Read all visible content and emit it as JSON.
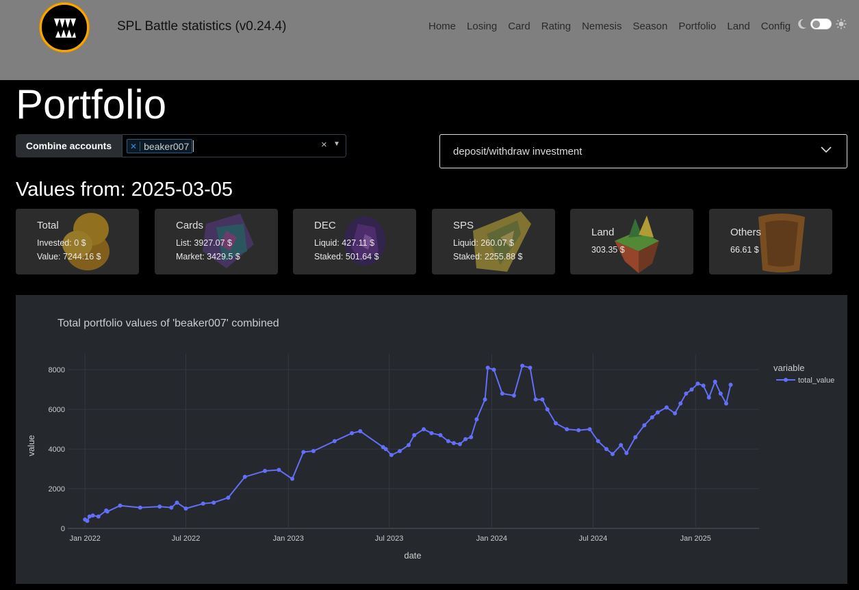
{
  "app": {
    "title": "SPL Battle statistics (v0.24.4)"
  },
  "nav": [
    "Home",
    "Losing",
    "Card",
    "Rating",
    "Nemesis",
    "Season",
    "Portfolio",
    "Land",
    "Config"
  ],
  "page": {
    "title": "Portfolio",
    "values_from": "Values from: 2025-03-05"
  },
  "filters": {
    "combine_label": "Combine accounts",
    "selected_accounts": [
      "beaker007"
    ],
    "dropdown_value": "deposit/withdraw investment"
  },
  "cards": [
    {
      "title": "Total",
      "lines": [
        "Invested: 0 $",
        "Value: 7244.16 $"
      ],
      "icon": "coins-icon"
    },
    {
      "title": "Cards",
      "lines": [
        "List: 3927.07 $",
        "Market: 3429.5 $"
      ],
      "icon": "cards-icon"
    },
    {
      "title": "DEC",
      "lines": [
        "Liquid: 427.11 $",
        "Staked: 501.64 $"
      ],
      "icon": "dec-crystal-icon"
    },
    {
      "title": "SPS",
      "lines": [
        "Liquid: 260.07 $",
        "Staked: 2255.88 $"
      ],
      "icon": "sps-crystal-icon"
    },
    {
      "title": "Land",
      "lines": [
        "303.35 $"
      ],
      "icon": "land-island-icon"
    },
    {
      "title": "Others",
      "lines": [
        "66.61 $"
      ],
      "icon": "chest-icon"
    }
  ],
  "colors": {
    "accent": "#636efa",
    "chart_bg": "#25282d",
    "navbar": "#7f7f7f"
  },
  "chart_data": {
    "type": "line",
    "title": "Total portfolio values of 'beaker007' combined",
    "xlabel": "date",
    "ylabel": "value",
    "ylim": [
      0,
      8800
    ],
    "xlim": [
      "2021-12-01",
      "2025-04-25"
    ],
    "x_ticks": [
      "Jan 2022",
      "Jul 2022",
      "Jan 2023",
      "Jul 2023",
      "Jan 2024",
      "Jul 2024",
      "Jan 2025"
    ],
    "x_tick_dates": [
      "2022-01-01",
      "2022-07-01",
      "2023-01-01",
      "2023-07-01",
      "2024-01-01",
      "2024-07-01",
      "2025-01-01"
    ],
    "y_ticks": [
      0,
      2000,
      4000,
      6000,
      8000
    ],
    "legend_title": "variable",
    "legend_position": "right",
    "grid": true,
    "series": [
      {
        "name": "total_value",
        "color": "#636efa",
        "x": [
          "2022-01-01",
          "2022-01-05",
          "2022-01-09",
          "2022-01-15",
          "2022-01-25",
          "2022-02-08",
          "2022-02-10",
          "2022-03-05",
          "2022-04-10",
          "2022-05-15",
          "2022-06-05",
          "2022-06-15",
          "2022-07-01",
          "2022-08-01",
          "2022-08-20",
          "2022-09-15",
          "2022-10-15",
          "2022-11-20",
          "2022-12-15",
          "2023-01-08",
          "2023-01-28",
          "2023-02-15",
          "2023-03-25",
          "2023-04-25",
          "2023-05-10",
          "2023-06-20",
          "2023-06-25",
          "2023-07-05",
          "2023-07-20",
          "2023-08-05",
          "2023-08-15",
          "2023-09-01",
          "2023-09-15",
          "2023-10-01",
          "2023-10-15",
          "2023-10-25",
          "2023-11-05",
          "2023-11-15",
          "2023-11-25",
          "2023-12-05",
          "2023-12-20",
          "2023-12-25",
          "2024-01-05",
          "2024-01-20",
          "2024-02-10",
          "2024-02-25",
          "2024-03-10",
          "2024-03-20",
          "2024-04-01",
          "2024-04-10",
          "2024-04-25",
          "2024-05-15",
          "2024-06-05",
          "2024-06-25",
          "2024-07-10",
          "2024-07-25",
          "2024-08-05",
          "2024-08-20",
          "2024-08-30",
          "2024-09-15",
          "2024-10-01",
          "2024-10-15",
          "2024-10-25",
          "2024-11-10",
          "2024-11-25",
          "2024-12-05",
          "2024-12-15",
          "2024-12-25",
          "2025-01-05",
          "2025-01-15",
          "2025-01-25",
          "2025-02-05",
          "2025-02-15",
          "2025-02-25",
          "2025-03-05"
        ],
        "values": [
          450,
          380,
          600,
          650,
          600,
          900,
          850,
          1150,
          1050,
          1100,
          1050,
          1300,
          1000,
          1250,
          1300,
          1550,
          2600,
          2900,
          2950,
          2500,
          3850,
          3900,
          4400,
          4800,
          4900,
          4100,
          4000,
          3700,
          3900,
          4200,
          4700,
          5000,
          4800,
          4700,
          4400,
          4300,
          4250,
          4500,
          4600,
          5500,
          6500,
          8100,
          8000,
          6800,
          6700,
          8200,
          8100,
          6500,
          6500,
          6000,
          5300,
          5000,
          4950,
          5000,
          4400,
          4000,
          3750,
          4200,
          3800,
          4600,
          5200,
          5600,
          5850,
          6100,
          5800,
          6300,
          6800,
          7000,
          7300,
          7200,
          6600,
          7400,
          6800,
          6300,
          7244
        ]
      }
    ]
  }
}
